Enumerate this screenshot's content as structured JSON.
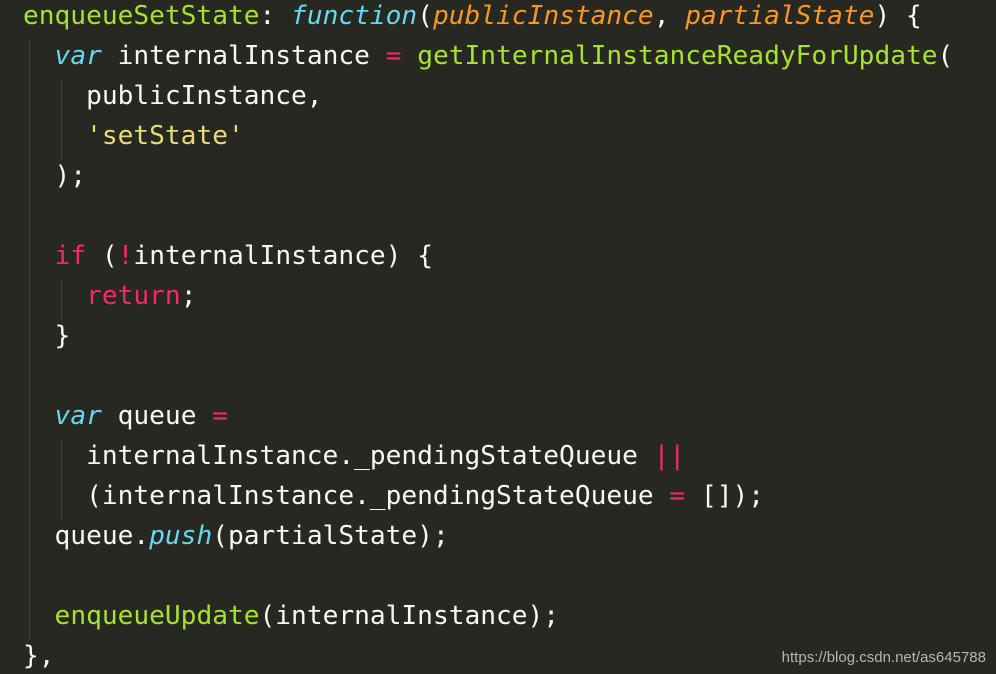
{
  "code": {
    "language": "javascript",
    "theme_colors": {
      "background": "#272822",
      "plain": "#f8f8f2",
      "function_name": "#a6e22e",
      "storage": "#66d9ef",
      "parameter": "#fd971f",
      "keyword": "#f92672",
      "string": "#e6db74"
    },
    "lines": [
      [
        {
          "text": "enqueueSetState",
          "kind": "function_name"
        },
        {
          "text": ": ",
          "kind": "plain"
        },
        {
          "text": "function",
          "kind": "storage"
        },
        {
          "text": "(",
          "kind": "plain"
        },
        {
          "text": "publicInstance",
          "kind": "parameter"
        },
        {
          "text": ", ",
          "kind": "plain"
        },
        {
          "text": "partialState",
          "kind": "parameter"
        },
        {
          "text": ") {",
          "kind": "plain"
        }
      ],
      [
        {
          "text": "  ",
          "kind": "plain"
        },
        {
          "text": "var",
          "kind": "storage"
        },
        {
          "text": " internalInstance ",
          "kind": "plain"
        },
        {
          "text": "=",
          "kind": "keyword"
        },
        {
          "text": " ",
          "kind": "plain"
        },
        {
          "text": "getInternalInstanceReadyForUpdate",
          "kind": "function_name"
        },
        {
          "text": "(",
          "kind": "plain"
        }
      ],
      [
        {
          "text": "    publicInstance,",
          "kind": "plain"
        }
      ],
      [
        {
          "text": "    ",
          "kind": "plain"
        },
        {
          "text": "'setState'",
          "kind": "string"
        }
      ],
      [
        {
          "text": "  );",
          "kind": "plain"
        }
      ],
      [],
      [
        {
          "text": "  ",
          "kind": "plain"
        },
        {
          "text": "if",
          "kind": "keyword"
        },
        {
          "text": " (",
          "kind": "plain"
        },
        {
          "text": "!",
          "kind": "keyword"
        },
        {
          "text": "internalInstance) {",
          "kind": "plain"
        }
      ],
      [
        {
          "text": "    ",
          "kind": "plain"
        },
        {
          "text": "return",
          "kind": "keyword"
        },
        {
          "text": ";",
          "kind": "plain"
        }
      ],
      [
        {
          "text": "  }",
          "kind": "plain"
        }
      ],
      [],
      [
        {
          "text": "  ",
          "kind": "plain"
        },
        {
          "text": "var",
          "kind": "storage"
        },
        {
          "text": " queue ",
          "kind": "plain"
        },
        {
          "text": "=",
          "kind": "keyword"
        }
      ],
      [
        {
          "text": "    internalInstance._pendingStateQueue ",
          "kind": "plain"
        },
        {
          "text": "||",
          "kind": "keyword"
        }
      ],
      [
        {
          "text": "    (internalInstance._pendingStateQueue ",
          "kind": "plain"
        },
        {
          "text": "=",
          "kind": "keyword"
        },
        {
          "text": " []);",
          "kind": "plain"
        }
      ],
      [
        {
          "text": "  queue.",
          "kind": "plain"
        },
        {
          "text": "push",
          "kind": "storage"
        },
        {
          "text": "(partialState);",
          "kind": "plain"
        }
      ],
      [],
      [
        {
          "text": "  ",
          "kind": "plain"
        },
        {
          "text": "enqueueUpdate",
          "kind": "function_name"
        },
        {
          "text": "(internalInstance);",
          "kind": "plain"
        }
      ],
      [
        {
          "text": "},",
          "kind": "plain"
        }
      ]
    ]
  },
  "watermark": "https://blog.csdn.net/as645788"
}
